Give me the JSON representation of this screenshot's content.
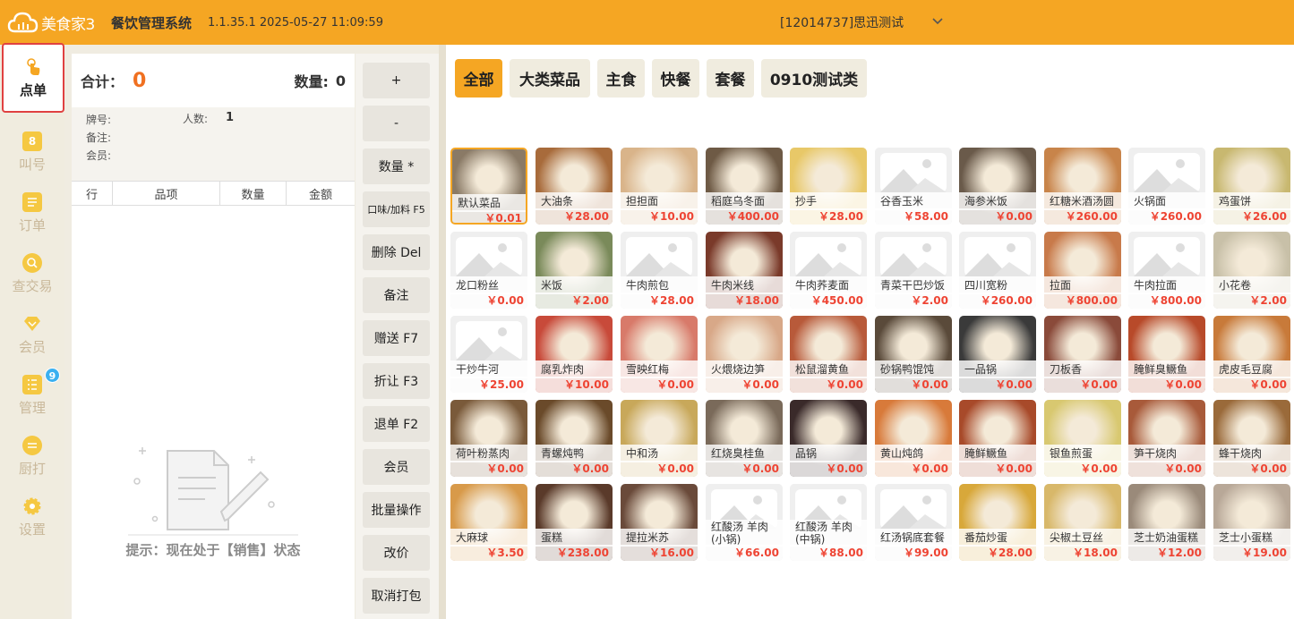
{
  "header": {
    "logo_text": "美食家3",
    "system_title": "餐饮管理系统",
    "version_info": "1.1.35.1 2025-05-27 11:09:59",
    "store": "[12014737]思迅测试"
  },
  "sidebar": {
    "items": [
      {
        "label": "点单",
        "icon": "tap-icon",
        "active": true
      },
      {
        "label": "叫号",
        "icon": "number-icon"
      },
      {
        "label": "订单",
        "icon": "order-icon"
      },
      {
        "label": "查交易",
        "icon": "search-icon"
      },
      {
        "label": "会员",
        "icon": "diamond-icon"
      },
      {
        "label": "管理",
        "icon": "manage-icon"
      },
      {
        "label": "厨打",
        "icon": "print-icon"
      },
      {
        "label": "设置",
        "icon": "gear-icon"
      }
    ],
    "kitchen_badge": "9"
  },
  "order": {
    "total_label": "合计：",
    "total_value": "0",
    "qty_label": "数量:",
    "qty_value": "0",
    "plate_label": "牌号:",
    "people_label": "人数:",
    "people_value": "1",
    "remark_label": "备注:",
    "member_label": "会员:",
    "columns": [
      "行",
      "品项",
      "数量",
      "金额"
    ],
    "tip": "提示：现在处于【销售】状态"
  },
  "functions": [
    "+",
    "-",
    "数量 *",
    "口味/加料 F5",
    "删除 Del",
    "备注",
    "赠送 F7",
    "折让 F3",
    "退单 F2",
    "会员",
    "批量操作",
    "改价",
    "取消打包"
  ],
  "categories": [
    {
      "label": "全部",
      "active": true
    },
    {
      "label": "大类菜品"
    },
    {
      "label": "主食"
    },
    {
      "label": "快餐"
    },
    {
      "label": "套餐"
    },
    {
      "label": "0910测试类"
    }
  ],
  "colors": {
    "brand": "#f5a623",
    "price": "#ee4433",
    "highlight": "#e04141"
  },
  "dishes": [
    {
      "name": "默认菜品",
      "price": "￥0.01",
      "color": "#8a7a66",
      "photo": true,
      "selected": true
    },
    {
      "name": "大油条",
      "price": "￥28.00",
      "color": "#a86b3b",
      "photo": true
    },
    {
      "name": "担担面",
      "price": "￥10.00",
      "color": "#d9b48a",
      "photo": true
    },
    {
      "name": "稻庭乌冬面",
      "price": "￥400.00",
      "color": "#6e5a45",
      "photo": true
    },
    {
      "name": "抄手",
      "price": "￥28.00",
      "color": "#e8c868",
      "photo": true
    },
    {
      "name": "谷香玉米",
      "price": "￥58.00",
      "photo": false
    },
    {
      "name": "海参米饭",
      "price": "￥0.00",
      "color": "#6a5a4a",
      "photo": true
    },
    {
      "name": "红糖米酒汤圆",
      "price": "￥260.00",
      "color": "#c8844a",
      "photo": true
    },
    {
      "name": "火锅面",
      "price": "￥260.00",
      "photo": false
    },
    {
      "name": "鸡蛋饼",
      "price": "￥26.00",
      "color": "#c8b870",
      "photo": true
    },
    {
      "name": "龙口粉丝",
      "price": "￥0.00",
      "photo": false
    },
    {
      "name": "米饭",
      "price": "￥2.00",
      "color": "#7a8a5a",
      "photo": true
    },
    {
      "name": "牛肉煎包",
      "price": "￥28.00",
      "photo": false
    },
    {
      "name": "牛肉米线",
      "price": "￥18.00",
      "color": "#7a3a2a",
      "photo": true
    },
    {
      "name": "牛肉荞麦面",
      "price": "￥450.00",
      "photo": false
    },
    {
      "name": "青菜干巴炒饭",
      "price": "￥2.00",
      "photo": false
    },
    {
      "name": "四川宽粉",
      "price": "￥260.00",
      "photo": false
    },
    {
      "name": "拉面",
      "price": "￥800.00",
      "color": "#c87a4a",
      "photo": true
    },
    {
      "name": "牛肉拉面",
      "price": "￥800.00",
      "photo": false
    },
    {
      "name": "小花卷",
      "price": "￥2.00",
      "color": "#c8c0a8",
      "photo": true
    },
    {
      "name": "干炒牛河",
      "price": "￥25.00",
      "photo": false
    },
    {
      "name": "腐乳炸肉",
      "price": "￥10.00",
      "color": "#c84a3a",
      "photo": true
    },
    {
      "name": "雪映红梅",
      "price": "￥0.00",
      "color": "#d87a6a",
      "photo": true
    },
    {
      "name": "火煨烧边笋",
      "price": "￥0.00",
      "color": "#d8a888",
      "photo": true
    },
    {
      "name": "松鼠溜黄鱼",
      "price": "￥0.00",
      "color": "#b85a3a",
      "photo": true
    },
    {
      "name": "砂锅鸭馄饨",
      "price": "￥0.00",
      "color": "#5a4a3a",
      "photo": true
    },
    {
      "name": "一品锅",
      "price": "￥0.00",
      "color": "#3a3a3a",
      "photo": true
    },
    {
      "name": "刀板香",
      "price": "￥0.00",
      "color": "#8a4a3a",
      "photo": true
    },
    {
      "name": "腌鲜臭鳜鱼",
      "price": "￥0.00",
      "color": "#b84a2a",
      "photo": true
    },
    {
      "name": "虎皮毛豆腐",
      "price": "￥0.00",
      "color": "#c87a3a",
      "photo": true
    },
    {
      "name": "荷叶粉蒸肉",
      "price": "￥0.00",
      "color": "#7a5a3a",
      "photo": true
    },
    {
      "name": "青螺炖鸭",
      "price": "￥0.00",
      "color": "#6a4a2a",
      "photo": true
    },
    {
      "name": "中和汤",
      "price": "￥0.00",
      "color": "#c8a85a",
      "photo": true
    },
    {
      "name": "红烧臭桂鱼",
      "price": "￥0.00",
      "color": "#7a6a5a",
      "photo": true
    },
    {
      "name": "品锅",
      "price": "￥0.00",
      "color": "#3a2a2a",
      "photo": true
    },
    {
      "name": "黄山炖鸽",
      "price": "￥0.00",
      "color": "#d87a3a",
      "photo": true
    },
    {
      "name": "腌鲜鳜鱼",
      "price": "￥0.00",
      "color": "#a84a2a",
      "photo": true
    },
    {
      "name": "银鱼煎蛋",
      "price": "￥0.00",
      "color": "#d8c870",
      "photo": true
    },
    {
      "name": "笋干烧肉",
      "price": "￥0.00",
      "color": "#a85a3a",
      "photo": true
    },
    {
      "name": "蜂干烧肉",
      "price": "￥0.00",
      "color": "#9a6a3a",
      "photo": true
    },
    {
      "name": "大麻球",
      "price": "￥3.50",
      "color": "#d89a4a",
      "photo": true
    },
    {
      "name": "蛋糕",
      "price": "￥238.00",
      "color": "#5a3a2a",
      "photo": true
    },
    {
      "name": "提拉米苏",
      "price": "￥16.00",
      "color": "#6a4a3a",
      "photo": true
    },
    {
      "name": "红酸汤 羊肉(小锅)",
      "price": "￥66.00",
      "photo": false
    },
    {
      "name": "红酸汤 羊肉(中锅)",
      "price": "￥88.00",
      "photo": false
    },
    {
      "name": "红汤锅底套餐",
      "price": "￥99.00",
      "photo": false
    },
    {
      "name": "番茄炒蛋",
      "price": "￥28.00",
      "color": "#d8a83a",
      "photo": true
    },
    {
      "name": "尖椒土豆丝",
      "price": "￥18.00",
      "color": "#d8b86a",
      "photo": true
    },
    {
      "name": "芝士奶油蛋糕",
      "price": "￥12.00",
      "color": "#9a8a7a",
      "photo": true
    },
    {
      "name": "芝士小蛋糕",
      "price": "￥19.00",
      "color": "#b8a898",
      "photo": true
    }
  ]
}
